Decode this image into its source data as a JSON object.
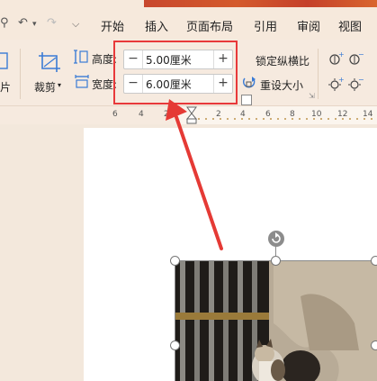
{
  "menu": {
    "items": [
      "开始",
      "插入",
      "页面布局",
      "引用",
      "审阅",
      "视图"
    ]
  },
  "ribbon": {
    "picture_label": "片",
    "crop_label": "裁剪",
    "height_label": "高度:",
    "width_label": "宽度:",
    "height_value": "5.00厘米",
    "width_value": "6.00厘米",
    "minus_symbol": "−",
    "plus_symbol": "+",
    "lock_ratio_label": "锁定纵横比",
    "reset_size_label": "重设大小"
  },
  "ruler": {
    "ticks": [
      "6",
      "4",
      "2",
      "2",
      "4",
      "6",
      "8",
      "10",
      "12",
      "14"
    ]
  },
  "colors": {
    "highlight": "#e8393a",
    "arrow": "#e53a35",
    "accent_blue": "#3a7bd5"
  }
}
